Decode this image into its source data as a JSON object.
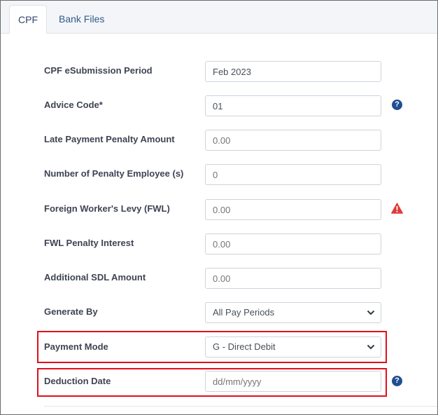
{
  "tabs": [
    {
      "label": "CPF",
      "active": true
    },
    {
      "label": "Bank Files",
      "active": false
    }
  ],
  "form": {
    "rows": [
      {
        "label": "CPF eSubmission Period",
        "value": "Feb 2023",
        "kind": "input"
      },
      {
        "label": "Advice Code*",
        "value": "01",
        "kind": "input",
        "icon": "help-icon"
      },
      {
        "label": "Late Payment Penalty Amount",
        "value": "",
        "placeholder": "0.00",
        "kind": "input"
      },
      {
        "label": "Number of Penalty Employee (s)",
        "value": "",
        "placeholder": "0",
        "kind": "input"
      },
      {
        "label": "Foreign Worker's Levy (FWL)",
        "value": "",
        "placeholder": "0.00",
        "kind": "input",
        "icon": "warning-icon"
      },
      {
        "label": "FWL Penalty Interest",
        "value": "",
        "placeholder": "0.00",
        "kind": "input"
      },
      {
        "label": "Additional SDL Amount",
        "value": "",
        "placeholder": "0.00",
        "kind": "input"
      },
      {
        "label": "Generate By",
        "value": "All Pay Periods",
        "kind": "select"
      },
      {
        "label": "Payment Mode",
        "value": "G - Direct Debit",
        "kind": "select",
        "highlighted": true
      },
      {
        "label": "Deduction Date",
        "value": "",
        "placeholder": "dd/mm/yyyy",
        "kind": "input",
        "icon": "help-icon",
        "highlighted": true
      }
    ]
  },
  "colors": {
    "highlight": "#e0101c",
    "help_icon": "#1f4f8f",
    "warning_icon": "#e03a3a",
    "tab_text": "#2f5b8c"
  }
}
